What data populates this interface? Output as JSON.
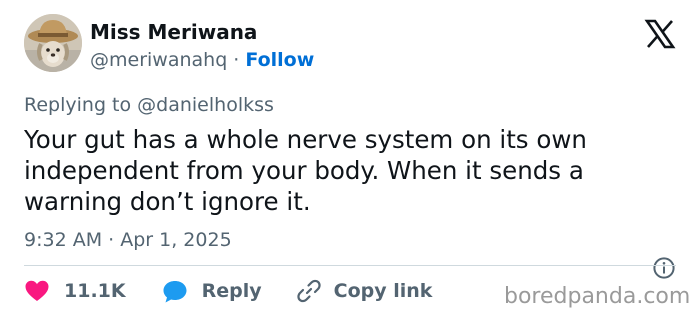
{
  "author": {
    "name": "Miss Meriwana",
    "handle": "@meriwanahq",
    "separator": " · ",
    "follow_label": "Follow"
  },
  "reply_context": {
    "prefix": "Replying to ",
    "handle": "@danielholkss"
  },
  "tweet": {
    "lines": [
      "Your gut has a whole nerve system on its own",
      "independent from your body. When it sends a",
      "warning don’t ignore it."
    ],
    "time": "9:32 AM",
    "separator": " · ",
    "date": "Apr 1, 2025"
  },
  "actions": {
    "like_count": "11.1K",
    "reply_label": "Reply",
    "copy_label": "Copy link"
  },
  "watermark": "boredpanda.com",
  "icons": {
    "logo": "x-logo-icon",
    "info": "info-icon",
    "like": "heart-icon",
    "reply": "speech-bubble-icon",
    "copy": "link-icon"
  },
  "colors": {
    "text": "#0f1419",
    "secondary": "#536471",
    "follow": "#006fd6",
    "like": "#f91880",
    "reply": "#1d9bf0",
    "divider": "#cfd9de"
  }
}
